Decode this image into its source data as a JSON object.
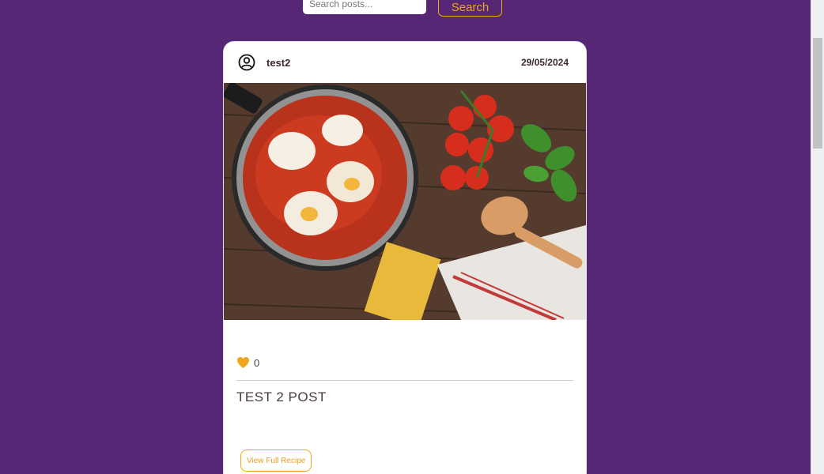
{
  "search": {
    "placeholder": "Search posts...",
    "button_label": "Search"
  },
  "post": {
    "username": "test2",
    "date": "29/05/2024",
    "like_count": "0",
    "title": "TEST 2 POST",
    "view_button_label": "View Full Recipe"
  },
  "colors": {
    "background": "#552774",
    "accent": "#f0a51c"
  },
  "icons": [
    "user-circle-icon",
    "heart-icon"
  ]
}
